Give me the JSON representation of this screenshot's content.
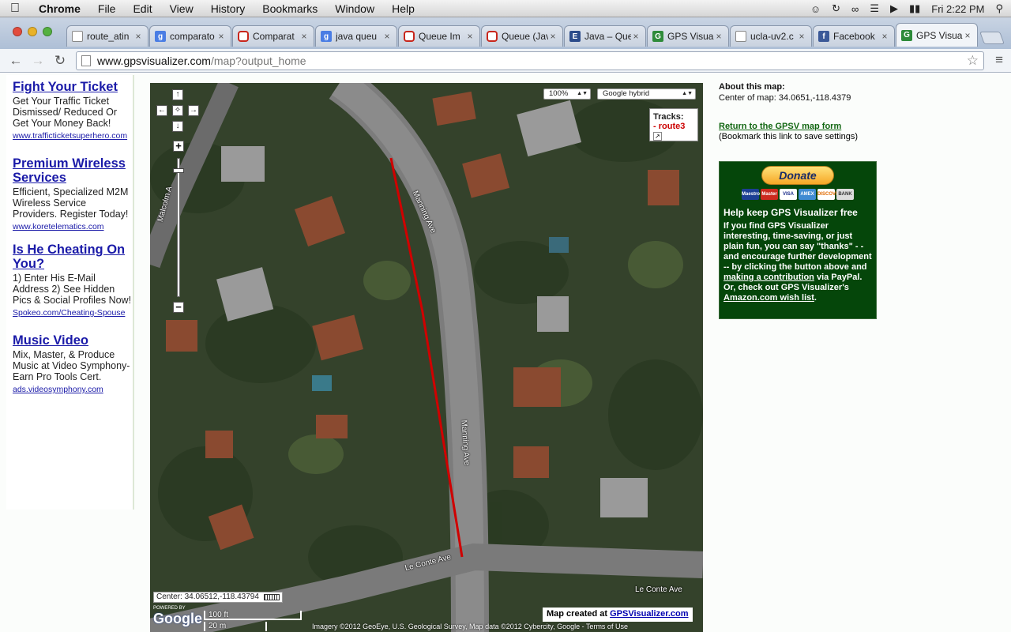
{
  "menubar": {
    "apple": "",
    "items": [
      "Chrome",
      "File",
      "Edit",
      "View",
      "History",
      "Bookmarks",
      "Window",
      "Help"
    ],
    "clock": "Fri 2:22 PM"
  },
  "tabs": [
    {
      "title": "route_atin",
      "icon": "doc"
    },
    {
      "title": "comparato",
      "icon": "g"
    },
    {
      "title": "Comparat",
      "icon": "o"
    },
    {
      "title": "java queu",
      "icon": "g"
    },
    {
      "title": "Queue Im",
      "icon": "o"
    },
    {
      "title": "Queue (Jav",
      "icon": "o"
    },
    {
      "title": "Java – Que",
      "icon": "e"
    },
    {
      "title": "GPS Visual",
      "icon": "gv"
    },
    {
      "title": "ucla-uv2.c",
      "icon": "doc"
    },
    {
      "title": "Facebook",
      "icon": "fb"
    },
    {
      "title": "GPS Visual",
      "icon": "gv",
      "active": true
    }
  ],
  "address": {
    "host": "www.gpsvisualizer.com",
    "path": "/map?output_home"
  },
  "ads": [
    {
      "title": "Fight Your Ticket",
      "body": "Get Your Traffic Ticket Dismissed/ Reduced Or Get Your Money Back!",
      "url": "www.trafficticketsuperhero.com"
    },
    {
      "title": "Premium Wireless Services",
      "body": "Efficient, Specialized M2M Wireless Service Providers. Register Today!",
      "url": "www.koretelematics.com"
    },
    {
      "title": "Is He Cheating On You?",
      "body": "1) Enter His E-Mail Address 2) See Hidden Pics & Social Profiles Now!",
      "url": "Spokeo.com/Cheating-Spouse"
    },
    {
      "title": "Music Video",
      "body": "Mix, Master, & Produce Music at Video Symphony-Earn Pro Tools Cert.",
      "url": "ads.videosymphony.com"
    }
  ],
  "map": {
    "zoom_select": "100%",
    "maptype_select": "Google hybrid",
    "tracks_label": "Tracks:",
    "track_name": "route3",
    "track_prefix": "-",
    "streets": {
      "manning1": "Manning Ave",
      "manning2": "Manning Ave",
      "malcolm": "Malcolm A",
      "leconte1": "Le Conte Ave",
      "leconte2": "Le Conte Ave"
    },
    "center_readout": "Center: 34.06512,-118.43794",
    "scale_ft": "100 ft",
    "scale_m": "20 m",
    "powered": "POWERED BY",
    "google": "Google",
    "credit_prefix": "Map created at",
    "credit_link": "GPSVisualizer.com",
    "copyright": "Imagery ©2012 GeoEye, U.S. Geological Survey, Map data ©2012 Cybercity, Google - Terms of Use"
  },
  "about": {
    "heading": "About this map:",
    "center_label": "Center of map:",
    "center_value": "34.0651,-118.4379",
    "return_link": "Return to the GPSV map form",
    "return_note": "(Bookmark this link to save settings)"
  },
  "donate": {
    "button": "Donate",
    "cards": [
      "Maestro",
      "Master",
      "VISA",
      "AMEX",
      "DISCOVER",
      "BANK"
    ],
    "heading": "Help keep GPS Visualizer free",
    "text1": "If you find GPS Visualizer interesting, time-saving, or just plain fun, you can say \"thanks\" - - and encourage further development -- by clicking the button above and ",
    "link1": "making a contribution",
    "text2": " via PayPal. Or, check out GPS Visualizer's ",
    "link2": "Amazon.com wish list",
    "text3": "."
  },
  "colors": {
    "track": "#d00000",
    "donate_bg": "#05460a",
    "ad_link": "#1a1aa8"
  }
}
